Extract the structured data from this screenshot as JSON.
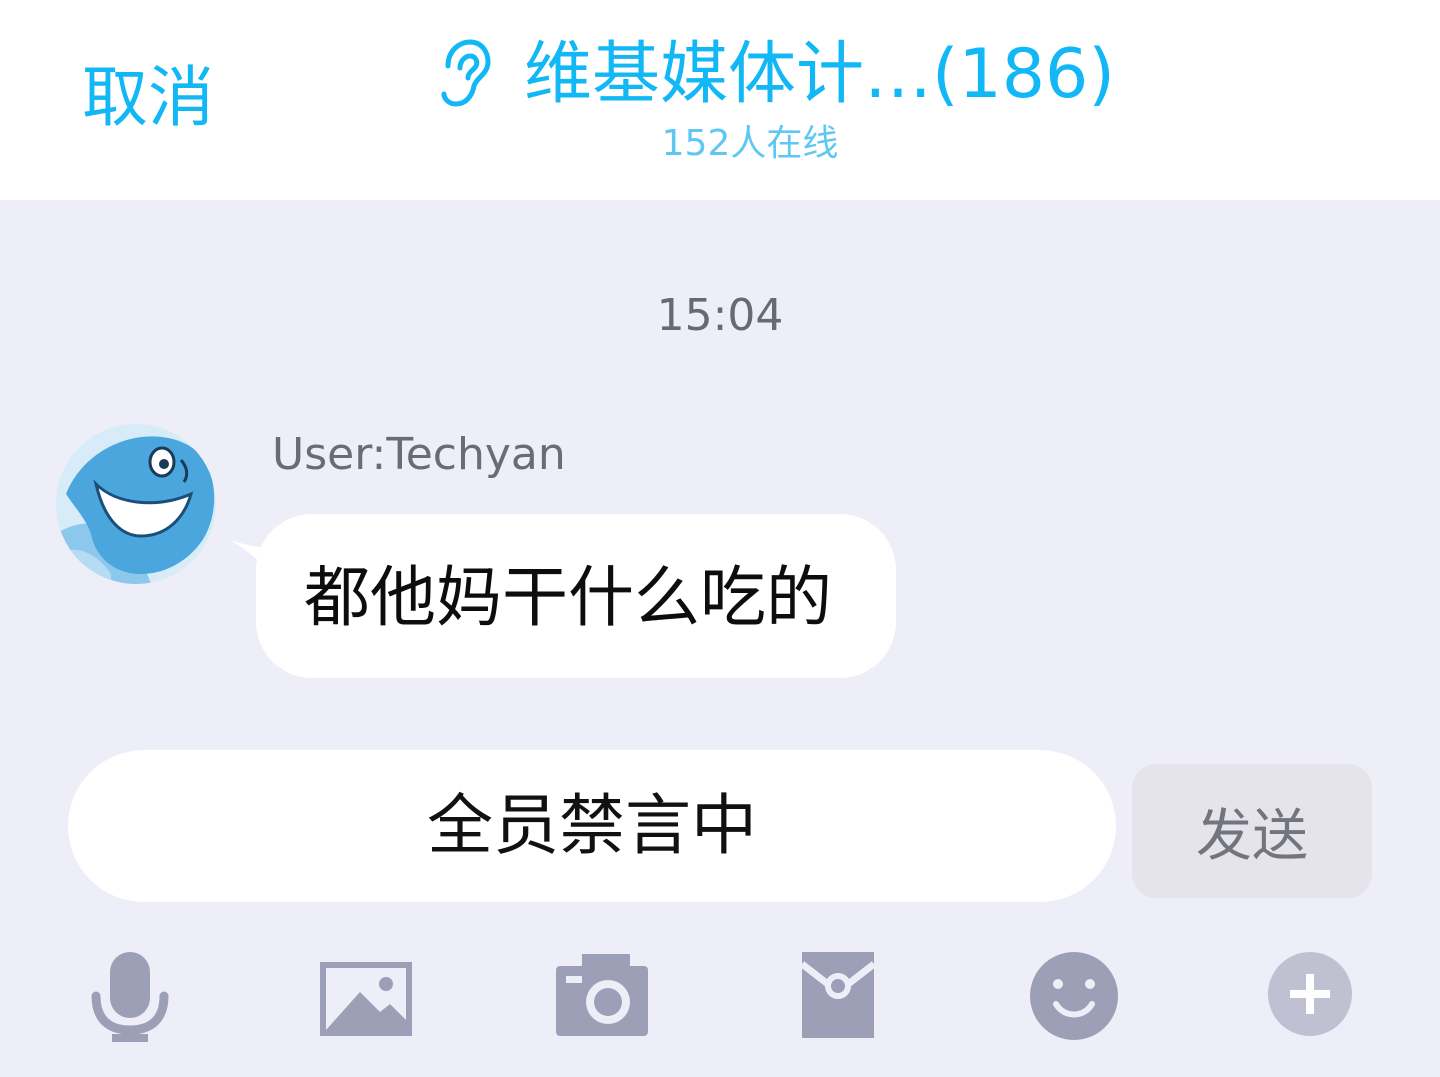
{
  "header": {
    "cancel_label": "取消",
    "title": "维基媒体计…(186)",
    "subtitle": "152人在线",
    "title_icon": "ear-icon"
  },
  "chat": {
    "timestamp": "15:04",
    "messages": [
      {
        "sender": "User:Techyan",
        "avatar": "dolphin-avatar",
        "text": "都他妈干什么吃的"
      }
    ]
  },
  "composer": {
    "input_text": "全员禁言中",
    "send_label": "发送"
  },
  "toolbar": {
    "icons": [
      "microphone-icon",
      "image-icon",
      "camera-icon",
      "red-packet-icon",
      "emoji-icon",
      "plus-icon"
    ]
  },
  "colors": {
    "accent": "#12b7f5",
    "background": "#edeef7",
    "icon_gray": "#9d9fb6"
  }
}
